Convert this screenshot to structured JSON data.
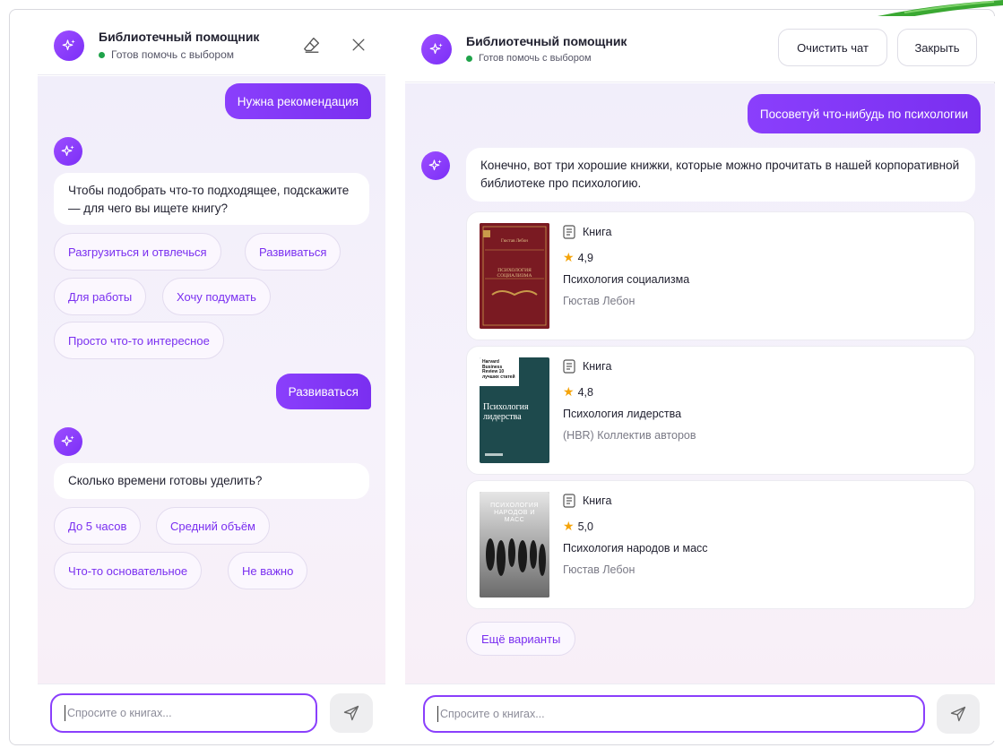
{
  "left_panel": {
    "title": "Библиотечный помощник",
    "status": "Готов помочь с выбором",
    "messages": {
      "user1": "Нужна рекомендация",
      "bot1": "Чтобы подобрать что-то подходящее, подскажите — для чего вы ищете книгу?",
      "chips1": [
        "Разгрузиться и отвлечься",
        "Развиваться",
        "Для работы",
        "Хочу подумать",
        "Просто что-то интересное"
      ],
      "user2": "Развиваться",
      "bot2": "Сколько времени готовы уделить?",
      "chips2": [
        "До 5 часов",
        "Средний объём",
        "Что-то основательное",
        "Не важно"
      ]
    },
    "input_placeholder": "Спросите о книгах..."
  },
  "right_panel": {
    "title": "Библиотечный помощник",
    "status": "Готов помочь с выбором",
    "clear_label": "Очистить чат",
    "close_label": "Закрыть",
    "user_message": "Посоветуй что-нибудь по психологии",
    "bot_message": "Конечно, вот три хорошие книжки, которые можно прочитать в нашей корпоративной библиотеке про психологию.",
    "books": [
      {
        "type": "Книга",
        "rating": "4,9",
        "title": "Психология социализма",
        "author": "Гюстав Лебон",
        "cover_text": "Гюстав Лебон",
        "cover_title": "ПСИХОЛОГИЯ СОЦИАЛИЗМА",
        "cover_color": "#7a1a22"
      },
      {
        "type": "Книга",
        "rating": "4,8",
        "title": "Психология лидерства",
        "author": "(HBR) Коллектив авторов",
        "cover_brand": "Harvard Business Review 10 лучших статей",
        "cover_title": "Психология лидерства",
        "cover_color": "#1e4a4d"
      },
      {
        "type": "Книга",
        "rating": "5,0",
        "title": "Психология народов и масс",
        "author": "Гюстав Лебон",
        "cover_title": "ПСИХОЛОГИЯ НАРОДОВ И МАСС",
        "cover_color": "#3a3a3a"
      }
    ],
    "more_label": "Ещё варианты",
    "input_placeholder": "Спросите о книгах..."
  },
  "colors": {
    "accent": "#8a3ffc",
    "status": "#1fa34a",
    "star": "#f5a40a"
  }
}
